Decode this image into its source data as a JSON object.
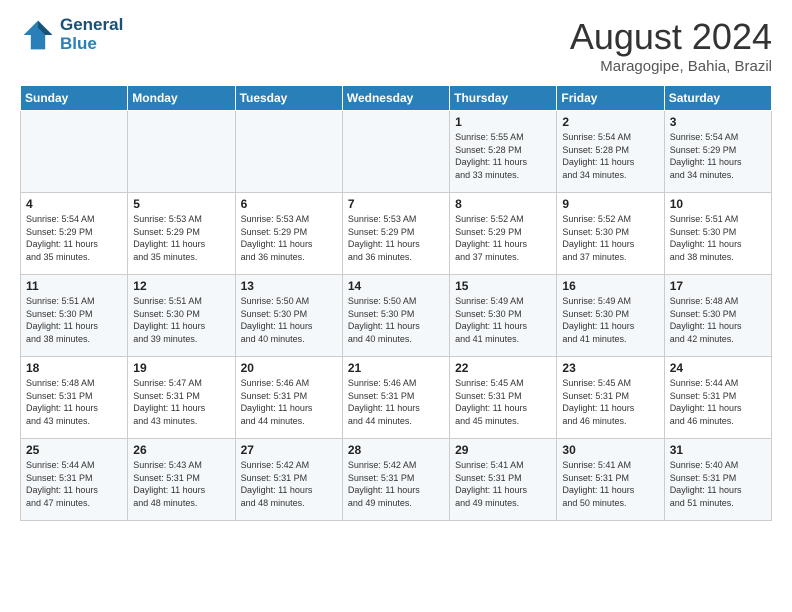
{
  "header": {
    "logo_line1": "General",
    "logo_line2": "Blue",
    "month_title": "August 2024",
    "location": "Maragogipe, Bahia, Brazil"
  },
  "weekdays": [
    "Sunday",
    "Monday",
    "Tuesday",
    "Wednesday",
    "Thursday",
    "Friday",
    "Saturday"
  ],
  "weeks": [
    [
      {
        "day": "",
        "info": ""
      },
      {
        "day": "",
        "info": ""
      },
      {
        "day": "",
        "info": ""
      },
      {
        "day": "",
        "info": ""
      },
      {
        "day": "1",
        "info": "Sunrise: 5:55 AM\nSunset: 5:28 PM\nDaylight: 11 hours\nand 33 minutes."
      },
      {
        "day": "2",
        "info": "Sunrise: 5:54 AM\nSunset: 5:28 PM\nDaylight: 11 hours\nand 34 minutes."
      },
      {
        "day": "3",
        "info": "Sunrise: 5:54 AM\nSunset: 5:29 PM\nDaylight: 11 hours\nand 34 minutes."
      }
    ],
    [
      {
        "day": "4",
        "info": "Sunrise: 5:54 AM\nSunset: 5:29 PM\nDaylight: 11 hours\nand 35 minutes."
      },
      {
        "day": "5",
        "info": "Sunrise: 5:53 AM\nSunset: 5:29 PM\nDaylight: 11 hours\nand 35 minutes."
      },
      {
        "day": "6",
        "info": "Sunrise: 5:53 AM\nSunset: 5:29 PM\nDaylight: 11 hours\nand 36 minutes."
      },
      {
        "day": "7",
        "info": "Sunrise: 5:53 AM\nSunset: 5:29 PM\nDaylight: 11 hours\nand 36 minutes."
      },
      {
        "day": "8",
        "info": "Sunrise: 5:52 AM\nSunset: 5:29 PM\nDaylight: 11 hours\nand 37 minutes."
      },
      {
        "day": "9",
        "info": "Sunrise: 5:52 AM\nSunset: 5:30 PM\nDaylight: 11 hours\nand 37 minutes."
      },
      {
        "day": "10",
        "info": "Sunrise: 5:51 AM\nSunset: 5:30 PM\nDaylight: 11 hours\nand 38 minutes."
      }
    ],
    [
      {
        "day": "11",
        "info": "Sunrise: 5:51 AM\nSunset: 5:30 PM\nDaylight: 11 hours\nand 38 minutes."
      },
      {
        "day": "12",
        "info": "Sunrise: 5:51 AM\nSunset: 5:30 PM\nDaylight: 11 hours\nand 39 minutes."
      },
      {
        "day": "13",
        "info": "Sunrise: 5:50 AM\nSunset: 5:30 PM\nDaylight: 11 hours\nand 40 minutes."
      },
      {
        "day": "14",
        "info": "Sunrise: 5:50 AM\nSunset: 5:30 PM\nDaylight: 11 hours\nand 40 minutes."
      },
      {
        "day": "15",
        "info": "Sunrise: 5:49 AM\nSunset: 5:30 PM\nDaylight: 11 hours\nand 41 minutes."
      },
      {
        "day": "16",
        "info": "Sunrise: 5:49 AM\nSunset: 5:30 PM\nDaylight: 11 hours\nand 41 minutes."
      },
      {
        "day": "17",
        "info": "Sunrise: 5:48 AM\nSunset: 5:30 PM\nDaylight: 11 hours\nand 42 minutes."
      }
    ],
    [
      {
        "day": "18",
        "info": "Sunrise: 5:48 AM\nSunset: 5:31 PM\nDaylight: 11 hours\nand 43 minutes."
      },
      {
        "day": "19",
        "info": "Sunrise: 5:47 AM\nSunset: 5:31 PM\nDaylight: 11 hours\nand 43 minutes."
      },
      {
        "day": "20",
        "info": "Sunrise: 5:46 AM\nSunset: 5:31 PM\nDaylight: 11 hours\nand 44 minutes."
      },
      {
        "day": "21",
        "info": "Sunrise: 5:46 AM\nSunset: 5:31 PM\nDaylight: 11 hours\nand 44 minutes."
      },
      {
        "day": "22",
        "info": "Sunrise: 5:45 AM\nSunset: 5:31 PM\nDaylight: 11 hours\nand 45 minutes."
      },
      {
        "day": "23",
        "info": "Sunrise: 5:45 AM\nSunset: 5:31 PM\nDaylight: 11 hours\nand 46 minutes."
      },
      {
        "day": "24",
        "info": "Sunrise: 5:44 AM\nSunset: 5:31 PM\nDaylight: 11 hours\nand 46 minutes."
      }
    ],
    [
      {
        "day": "25",
        "info": "Sunrise: 5:44 AM\nSunset: 5:31 PM\nDaylight: 11 hours\nand 47 minutes."
      },
      {
        "day": "26",
        "info": "Sunrise: 5:43 AM\nSunset: 5:31 PM\nDaylight: 11 hours\nand 48 minutes."
      },
      {
        "day": "27",
        "info": "Sunrise: 5:42 AM\nSunset: 5:31 PM\nDaylight: 11 hours\nand 48 minutes."
      },
      {
        "day": "28",
        "info": "Sunrise: 5:42 AM\nSunset: 5:31 PM\nDaylight: 11 hours\nand 49 minutes."
      },
      {
        "day": "29",
        "info": "Sunrise: 5:41 AM\nSunset: 5:31 PM\nDaylight: 11 hours\nand 49 minutes."
      },
      {
        "day": "30",
        "info": "Sunrise: 5:41 AM\nSunset: 5:31 PM\nDaylight: 11 hours\nand 50 minutes."
      },
      {
        "day": "31",
        "info": "Sunrise: 5:40 AM\nSunset: 5:31 PM\nDaylight: 11 hours\nand 51 minutes."
      }
    ]
  ]
}
